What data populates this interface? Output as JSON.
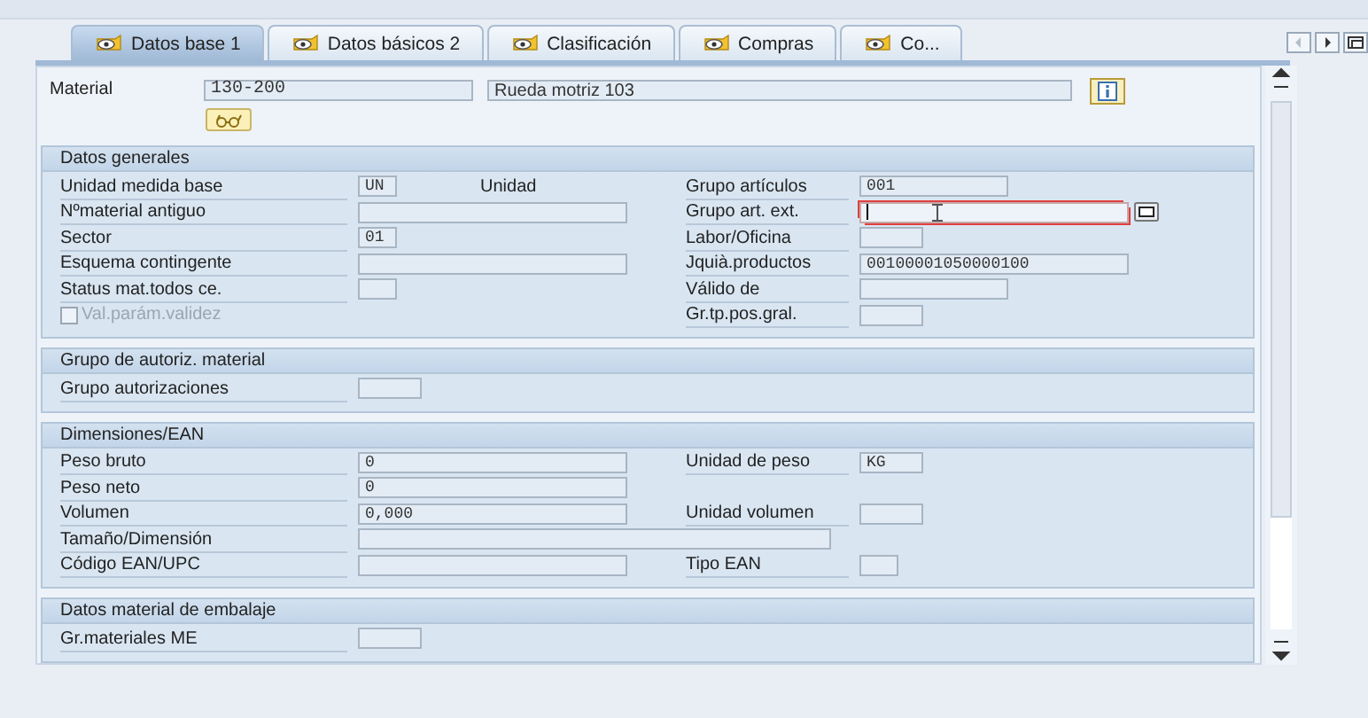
{
  "tabs": [
    {
      "label": "Datos base 1",
      "selected": true
    },
    {
      "label": "Datos básicos 2",
      "selected": false
    },
    {
      "label": "Clasificación",
      "selected": false
    },
    {
      "label": "Compras",
      "selected": false
    },
    {
      "label": "Co...",
      "selected": false
    }
  ],
  "header": {
    "label": "Material",
    "material": "130-200",
    "description": "Rueda motriz 103"
  },
  "groups": [
    {
      "title": "Datos generales",
      "rows": [
        {
          "label": "Unidad medida base",
          "field": {
            "kind": "tiny",
            "value": "UN"
          },
          "note": "Unidad",
          "right_label": "Grupo artículos",
          "right_field": {
            "kind": "medium",
            "value": "001"
          }
        },
        {
          "label": "Nºmaterial antiguo",
          "field": {
            "kind": "long"
          },
          "right_label": "Grupo art. ext.",
          "right_field": {
            "kind": "long",
            "focused": true,
            "value_help": true
          }
        },
        {
          "label": "Sector",
          "field": {
            "kind": "tiny",
            "value": "01"
          },
          "right_label": "Labor/Oficina",
          "right_field": {
            "kind": "short"
          }
        },
        {
          "label": "Esquema contingente",
          "field": {
            "kind": "long"
          },
          "right_label": "Jquià.productos",
          "right_field": {
            "kind": "long",
            "value": "00100001050000100"
          }
        },
        {
          "label": "Status mat.todos ce.",
          "field": {
            "kind": "tiny"
          },
          "right_label": "Válido de",
          "right_field": {
            "kind": "medium"
          }
        },
        {
          "checkbox": {
            "label": "Val.parám.validez",
            "checked": false,
            "disabled": true
          },
          "right_label": "Gr.tp.pos.gral.",
          "right_field": {
            "kind": "short"
          }
        }
      ]
    },
    {
      "title": "Grupo de autoriz. material",
      "rows": [
        {
          "label": "Grupo autorizaciones",
          "field": {
            "kind": "short"
          }
        }
      ]
    },
    {
      "title": "Dimensiones/EAN",
      "rows": [
        {
          "label": "Peso bruto",
          "field": {
            "kind": "long",
            "value": "0"
          },
          "right_label": "Unidad de peso",
          "right_field": {
            "kind": "short",
            "value": "KG"
          }
        },
        {
          "label": "Peso neto",
          "field": {
            "kind": "long",
            "value": "0"
          }
        },
        {
          "label": "Volumen",
          "field": {
            "kind": "long",
            "value": "0,000"
          },
          "right_label": "Unidad volumen",
          "right_field": {
            "kind": "short"
          }
        },
        {
          "label": "Tamaño/Dimensión",
          "field": {
            "kind": "wide"
          }
        },
        {
          "label": "Código EAN/UPC",
          "field": {
            "kind": "long"
          },
          "right_label": "Tipo EAN",
          "right_field": {
            "kind": "tiny"
          }
        }
      ]
    },
    {
      "title": "Datos material de embalaje",
      "rows": [
        {
          "label": "Gr.materiales ME",
          "field": {
            "kind": "short"
          }
        }
      ]
    }
  ]
}
